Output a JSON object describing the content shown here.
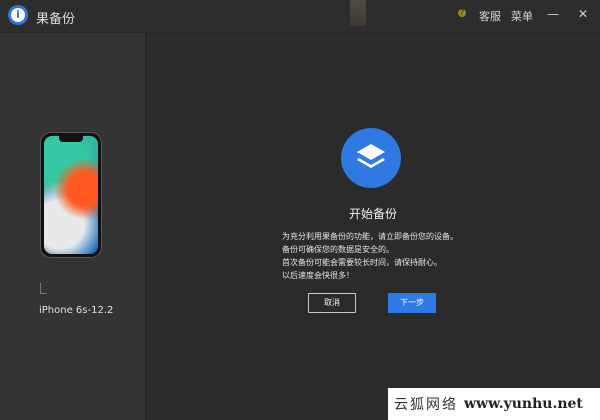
{
  "window": {
    "title": "果备份",
    "menu": {
      "help": "客服",
      "menu": "菜单"
    }
  },
  "sidebar": {
    "device_name": "iPhone 6s-12.2"
  },
  "main": {
    "heading": "开始备份",
    "description": [
      "为充分利用果备份的功能，请立即备份您的设备。",
      "备份可确保您的数据是安全的。",
      "首次备份可能会需要较长时间，请保持耐心。",
      "以后速度会快很多！"
    ],
    "buttons": {
      "cancel": "取消",
      "next": "下一步"
    }
  },
  "watermark": {
    "cn": "云狐网络",
    "url": "www.yunhu.net"
  },
  "colors": {
    "accent": "#2f7be6",
    "background": "#2b2b2b",
    "sidebar": "#343434"
  },
  "icons": [
    "app-logo-icon",
    "minimize-icon",
    "close-icon",
    "layers-icon"
  ]
}
